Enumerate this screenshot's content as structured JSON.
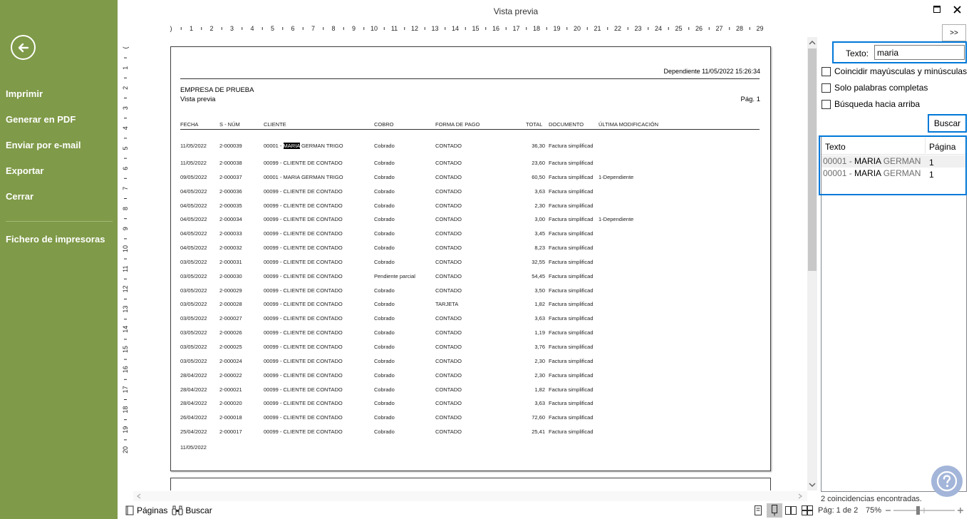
{
  "window": {
    "title": "Vista previa"
  },
  "sidebar": {
    "back_icon": "arrow-left-circle-icon",
    "items": [
      {
        "label": "Imprimir"
      },
      {
        "label": "Generar en PDF"
      },
      {
        "label": "Enviar por e-mail"
      },
      {
        "label": "Exportar"
      },
      {
        "label": "Cerrar"
      },
      {
        "label": "Fichero de impresoras"
      }
    ],
    "bg_color": "#7f9a48"
  },
  "rulers": {
    "horizontal": [
      ")",
      "1",
      "2",
      "3",
      "4",
      "5",
      "6",
      "7",
      "8",
      "9",
      "10",
      "11",
      "12",
      "13",
      "14",
      "15",
      "16",
      "17",
      "18",
      "19",
      "20",
      "21",
      "22",
      "23",
      "24",
      "25",
      "26",
      "27",
      "28",
      "29"
    ],
    "vertical": [
      "(",
      "1",
      "2",
      "3",
      "4",
      "5",
      "6",
      "7",
      "8",
      "9",
      "10",
      "11",
      "12",
      "13",
      "14",
      "15",
      "16",
      "17",
      "18",
      "19",
      "20"
    ]
  },
  "report": {
    "header_right": "Dependiente 11/05/2022 15:26:34",
    "company": "EMPRESA DE PRUEBA",
    "subtitle": "Vista previa",
    "page_label": "Pág. 1",
    "columns": [
      "FECHA",
      "S - NÚM",
      "CLIENTE",
      "COBRO",
      "FORMA DE PAGO",
      "TOTAL",
      "DOCUMENTO",
      "ÚLTIMA MODIFICACIÓN"
    ],
    "rows": [
      {
        "fecha": "11/05/2022",
        "num": "2-000039",
        "cliente_pre": "00001 - ",
        "cliente_hl": "MARIA",
        "cliente_post": " GERMAN TRIGO",
        "cobro": "Cobrado",
        "pago": "CONTADO",
        "total": "36,30",
        "doc": "Factura simplificad",
        "mod": ""
      },
      {
        "fecha": "11/05/2022",
        "num": "2-000038",
        "cliente_pre": "00099 - CLIENTE DE CONTADO",
        "cliente_hl": "",
        "cliente_post": "",
        "cobro": "Cobrado",
        "pago": "CONTADO",
        "total": "23,60",
        "doc": "Factura simplificad",
        "mod": ""
      },
      {
        "fecha": "09/05/2022",
        "num": "2-000037",
        "cliente_pre": "00001 - MARIA GERMAN TRIGO",
        "cliente_hl": "",
        "cliente_post": "",
        "cobro": "Cobrado",
        "pago": "CONTADO",
        "total": "60,50",
        "doc": "Factura simplificad",
        "mod": "1-Dependiente"
      },
      {
        "fecha": "04/05/2022",
        "num": "2-000036",
        "cliente_pre": "00099 - CLIENTE DE CONTADO",
        "cliente_hl": "",
        "cliente_post": "",
        "cobro": "Cobrado",
        "pago": "CONTADO",
        "total": "3,63",
        "doc": "Factura simplificad",
        "mod": ""
      },
      {
        "fecha": "04/05/2022",
        "num": "2-000035",
        "cliente_pre": "00099 - CLIENTE DE CONTADO",
        "cliente_hl": "",
        "cliente_post": "",
        "cobro": "Cobrado",
        "pago": "CONTADO",
        "total": "2,30",
        "doc": "Factura simplificad",
        "mod": ""
      },
      {
        "fecha": "04/05/2022",
        "num": "2-000034",
        "cliente_pre": "00099 - CLIENTE DE CONTADO",
        "cliente_hl": "",
        "cliente_post": "",
        "cobro": "Cobrado",
        "pago": "CONTADO",
        "total": "3,00",
        "doc": "Factura simplificad",
        "mod": "1-Dependiente"
      },
      {
        "fecha": "04/05/2022",
        "num": "2-000033",
        "cliente_pre": "00099 - CLIENTE DE CONTADO",
        "cliente_hl": "",
        "cliente_post": "",
        "cobro": "Cobrado",
        "pago": "CONTADO",
        "total": "3,45",
        "doc": "Factura simplificad",
        "mod": ""
      },
      {
        "fecha": "04/05/2022",
        "num": "2-000032",
        "cliente_pre": "00099 - CLIENTE DE CONTADO",
        "cliente_hl": "",
        "cliente_post": "",
        "cobro": "Cobrado",
        "pago": "CONTADO",
        "total": "8,23",
        "doc": "Factura simplificad",
        "mod": ""
      },
      {
        "fecha": "03/05/2022",
        "num": "2-000031",
        "cliente_pre": "00099 - CLIENTE DE CONTADO",
        "cliente_hl": "",
        "cliente_post": "",
        "cobro": "Cobrado",
        "pago": "CONTADO",
        "total": "32,55",
        "doc": "Factura simplificad",
        "mod": ""
      },
      {
        "fecha": "03/05/2022",
        "num": "2-000030",
        "cliente_pre": "00099 - CLIENTE DE CONTADO",
        "cliente_hl": "",
        "cliente_post": "",
        "cobro": "Pendiente parcial",
        "pago": "CONTADO",
        "total": "54,45",
        "doc": "Factura simplificad",
        "mod": ""
      },
      {
        "fecha": "03/05/2022",
        "num": "2-000029",
        "cliente_pre": "00099 - CLIENTE DE CONTADO",
        "cliente_hl": "",
        "cliente_post": "",
        "cobro": "Cobrado",
        "pago": "CONTADO",
        "total": "3,50",
        "doc": "Factura simplificad",
        "mod": ""
      },
      {
        "fecha": "03/05/2022",
        "num": "2-000028",
        "cliente_pre": "00099 - CLIENTE DE CONTADO",
        "cliente_hl": "",
        "cliente_post": "",
        "cobro": "Cobrado",
        "pago": "TARJETA",
        "total": "1,82",
        "doc": "Factura simplificad",
        "mod": ""
      },
      {
        "fecha": "03/05/2022",
        "num": "2-000027",
        "cliente_pre": "00099 - CLIENTE DE CONTADO",
        "cliente_hl": "",
        "cliente_post": "",
        "cobro": "Cobrado",
        "pago": "CONTADO",
        "total": "3,63",
        "doc": "Factura simplificad",
        "mod": ""
      },
      {
        "fecha": "03/05/2022",
        "num": "2-000026",
        "cliente_pre": "00099 - CLIENTE DE CONTADO",
        "cliente_hl": "",
        "cliente_post": "",
        "cobro": "Cobrado",
        "pago": "CONTADO",
        "total": "1,19",
        "doc": "Factura simplificad",
        "mod": ""
      },
      {
        "fecha": "03/05/2022",
        "num": "2-000025",
        "cliente_pre": "00099 - CLIENTE DE CONTADO",
        "cliente_hl": "",
        "cliente_post": "",
        "cobro": "Cobrado",
        "pago": "CONTADO",
        "total": "3,76",
        "doc": "Factura simplificad",
        "mod": ""
      },
      {
        "fecha": "03/05/2022",
        "num": "2-000024",
        "cliente_pre": "00099 - CLIENTE DE CONTADO",
        "cliente_hl": "",
        "cliente_post": "",
        "cobro": "Cobrado",
        "pago": "CONTADO",
        "total": "2,30",
        "doc": "Factura simplificad",
        "mod": ""
      },
      {
        "fecha": "28/04/2022",
        "num": "2-000022",
        "cliente_pre": "00099 - CLIENTE DE CONTADO",
        "cliente_hl": "",
        "cliente_post": "",
        "cobro": "Cobrado",
        "pago": "CONTADO",
        "total": "2,30",
        "doc": "Factura simplificad",
        "mod": ""
      },
      {
        "fecha": "28/04/2022",
        "num": "2-000021",
        "cliente_pre": "00099 - CLIENTE DE CONTADO",
        "cliente_hl": "",
        "cliente_post": "",
        "cobro": "Cobrado",
        "pago": "CONTADO",
        "total": "1,82",
        "doc": "Factura simplificad",
        "mod": ""
      },
      {
        "fecha": "28/04/2022",
        "num": "2-000020",
        "cliente_pre": "00099 - CLIENTE DE CONTADO",
        "cliente_hl": "",
        "cliente_post": "",
        "cobro": "Cobrado",
        "pago": "CONTADO",
        "total": "3,63",
        "doc": "Factura simplificad",
        "mod": ""
      },
      {
        "fecha": "26/04/2022",
        "num": "2-000018",
        "cliente_pre": "00099 - CLIENTE DE CONTADO",
        "cliente_hl": "",
        "cliente_post": "",
        "cobro": "Cobrado",
        "pago": "CONTADO",
        "total": "72,60",
        "doc": "Factura simplificad",
        "mod": ""
      },
      {
        "fecha": "25/04/2022",
        "num": "2-000017",
        "cliente_pre": "00099 - CLIENTE DE CONTADO",
        "cliente_hl": "",
        "cliente_post": "",
        "cobro": "Cobrado",
        "pago": "CONTADO",
        "total": "25,41",
        "doc": "Factura simplificad",
        "mod": ""
      }
    ],
    "footer_date": "11/05/2022"
  },
  "search": {
    "expand_label": ">>",
    "text_label": "Texto:",
    "text_value": "maria",
    "options": [
      {
        "label": "Coincidir mayúsculas y minúsculas",
        "checked": false
      },
      {
        "label": "Solo palabras completas",
        "checked": false
      },
      {
        "label": "Búsqueda hacia arriba",
        "checked": false
      }
    ],
    "button_label": "Buscar",
    "results_headers": [
      "Texto",
      "Página"
    ],
    "results": [
      {
        "pre": "00001 - ",
        "match": "MARIA",
        "post": " GERMAN T",
        "page": "1"
      },
      {
        "pre": "00001 - ",
        "match": "MARIA",
        "post": " GERMAN T",
        "page": "1"
      }
    ],
    "matches_text": "2 coincidencias encontradas.",
    "accent_color": "#0078d7"
  },
  "statusbar": {
    "pages_label": "Páginas",
    "search_label": "Buscar",
    "page_info": "Pág: 1 de 2",
    "zoom": "75%"
  },
  "icons": {
    "minimize": "maximize-icon",
    "close": "close-icon",
    "help": "help-circle-icon"
  }
}
